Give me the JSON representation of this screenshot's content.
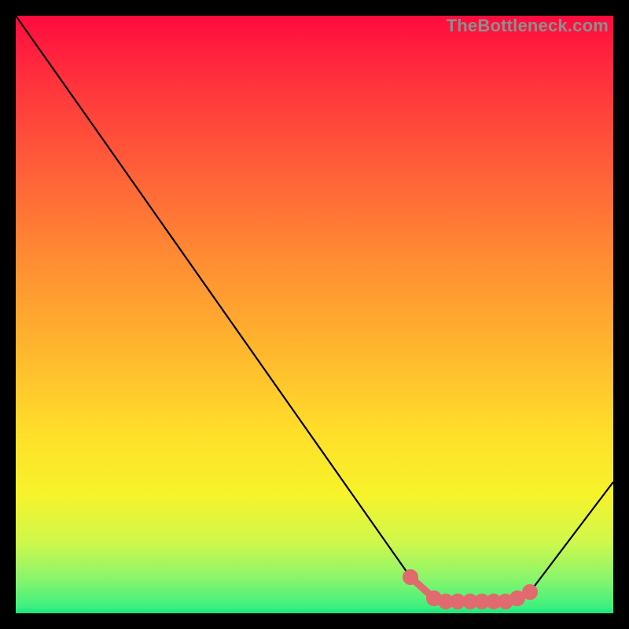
{
  "watermark": "TheBottleneck.com",
  "chart_data": {
    "type": "line",
    "title": "",
    "xlabel": "",
    "ylabel": "",
    "xlim": [
      0,
      100
    ],
    "ylim": [
      0,
      100
    ],
    "series": [
      {
        "name": "curve",
        "x": [
          0,
          12,
          66,
          70,
          72,
          74,
          76,
          78,
          80,
          82,
          84,
          86,
          100
        ],
        "y": [
          100,
          83,
          6,
          2.5,
          2,
          2,
          2,
          2,
          2,
          2,
          2.5,
          3.5,
          22
        ]
      }
    ],
    "highlight_range_x": [
      66,
      86
    ],
    "gradient_stops": [
      {
        "pos": 0,
        "color": "#ff0b3e"
      },
      {
        "pos": 10,
        "color": "#ff2f3d"
      },
      {
        "pos": 24,
        "color": "#ff5a39"
      },
      {
        "pos": 40,
        "color": "#ff8a33"
      },
      {
        "pos": 55,
        "color": "#ffb42e"
      },
      {
        "pos": 70,
        "color": "#ffdf2a"
      },
      {
        "pos": 80,
        "color": "#f6f32a"
      },
      {
        "pos": 88,
        "color": "#d0f84b"
      },
      {
        "pos": 94,
        "color": "#8cf56a"
      },
      {
        "pos": 99,
        "color": "#3df07f"
      },
      {
        "pos": 100,
        "color": "#14e57a"
      }
    ],
    "colors": {
      "curve": "#000000",
      "highlight": "#e16a6e",
      "background_frame": "#000000"
    }
  }
}
